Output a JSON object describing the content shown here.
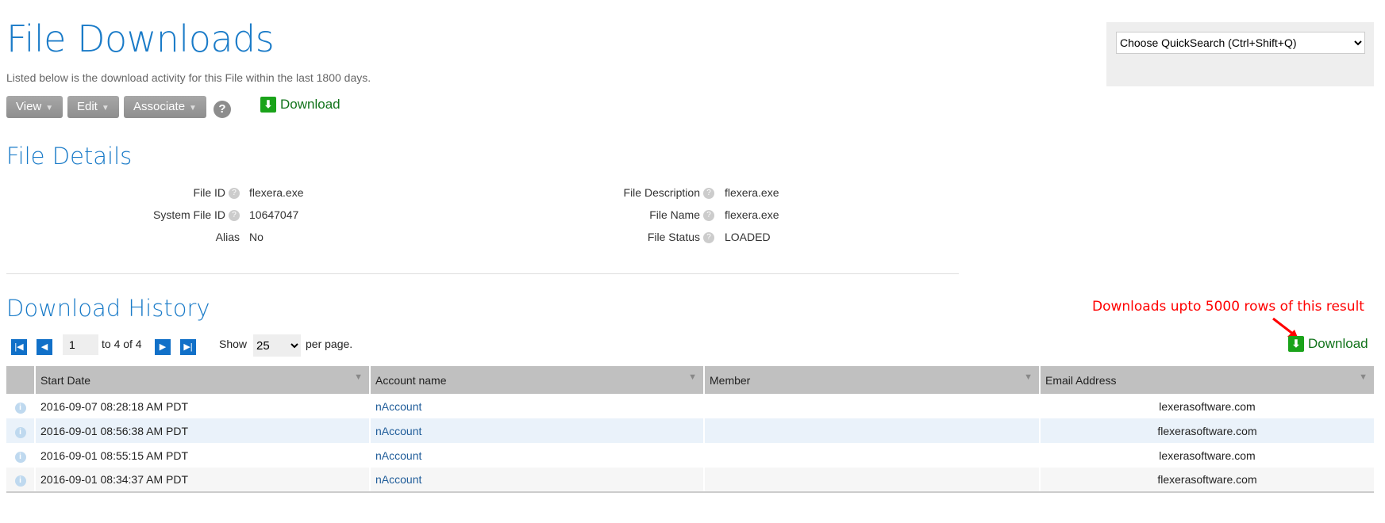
{
  "header": {
    "title": "File Downloads",
    "subtitle": "Listed below is the download activity for this File within the last 1800 days."
  },
  "toolbar": {
    "view": "View",
    "edit": "Edit",
    "associate": "Associate",
    "help": "?",
    "download": "Download"
  },
  "quicksearch": {
    "selected": "Choose QuickSearch (Ctrl+Shift+Q)"
  },
  "details": {
    "title": "File Details",
    "left": [
      {
        "label": "File ID",
        "value": "flexera.exe"
      },
      {
        "label": "System File ID",
        "value": "10647047"
      },
      {
        "label": "Alias",
        "value": "No"
      }
    ],
    "right": [
      {
        "label": "File Description",
        "value": "flexera.exe"
      },
      {
        "label": "File Name",
        "value": "flexera.exe"
      },
      {
        "label": "File Status",
        "value": "LOADED"
      }
    ]
  },
  "history": {
    "title": "Download History",
    "annotation": "Downloads upto 5000 rows of this result",
    "annotation_color": "#ff0000",
    "download": "Download",
    "pager": {
      "page": "1",
      "range": "to 4 of 4",
      "show": "Show",
      "per_page": "25",
      "per_page_suffix": "per page."
    },
    "columns": [
      "Start Date",
      "Account name",
      "Member",
      "Email Address"
    ],
    "rows": [
      {
        "date": "2016-09-07 08:28:18 AM PDT",
        "account": "nAccount",
        "member": "",
        "email": "lexerasoftware.com"
      },
      {
        "date": "2016-09-01 08:56:38 AM PDT",
        "account": "nAccount",
        "member": "",
        "email": "flexerasoftware.com"
      },
      {
        "date": "2016-09-01 08:55:15 AM PDT",
        "account": "nAccount",
        "member": "",
        "email": "lexerasoftware.com"
      },
      {
        "date": "2016-09-01 08:34:37 AM PDT",
        "account": "nAccount",
        "member": "",
        "email": "flexerasoftware.com"
      }
    ]
  }
}
